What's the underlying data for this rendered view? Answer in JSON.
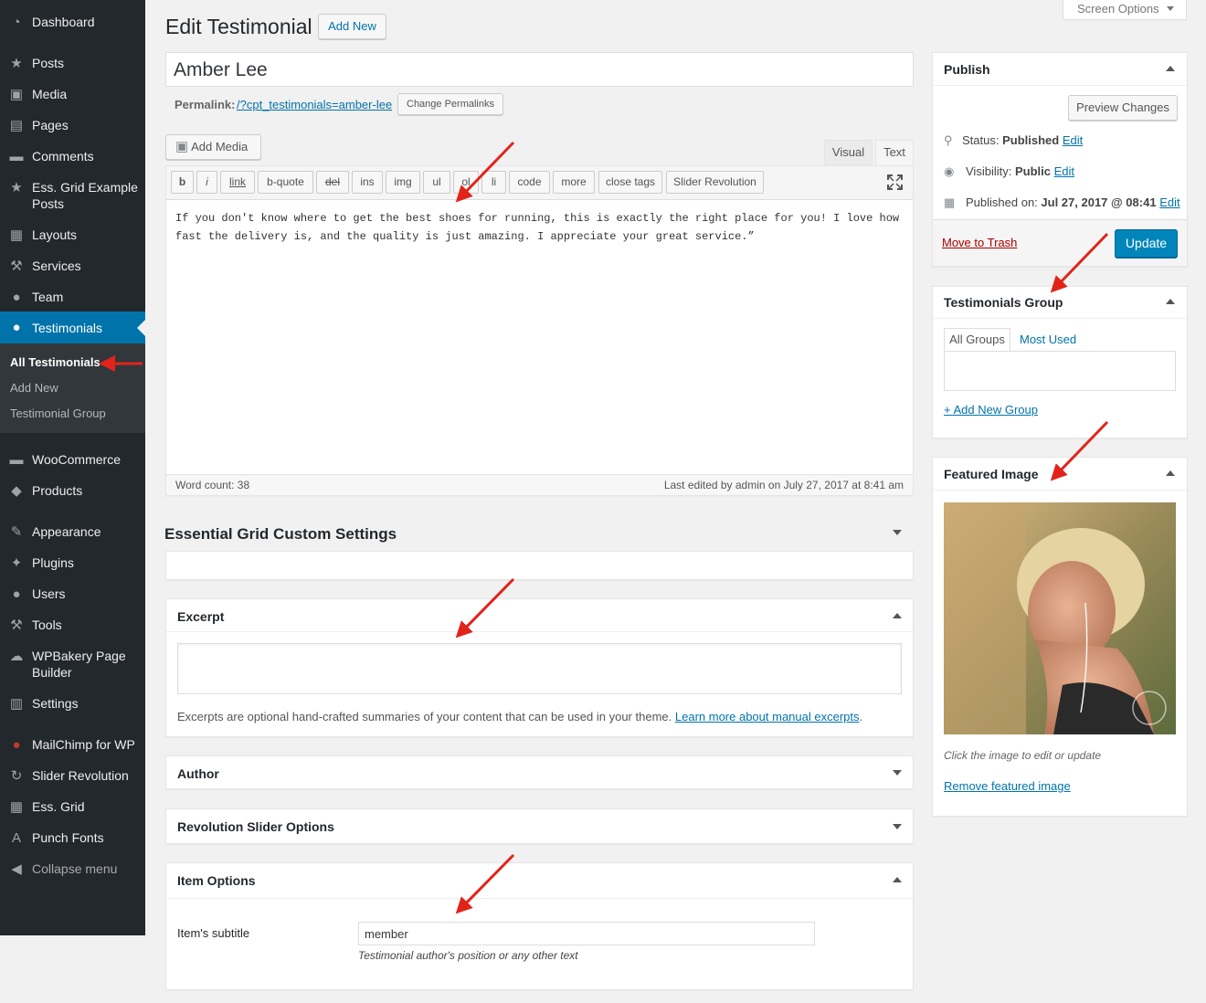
{
  "sidebar": {
    "items": [
      {
        "label": "Dashboard",
        "icon": "dashboard-icon",
        "glyph": "◔"
      },
      {
        "label": "Posts",
        "icon": "pushpin-icon",
        "glyph": "★"
      },
      {
        "label": "Media",
        "icon": "media-icon",
        "glyph": "▣"
      },
      {
        "label": "Pages",
        "icon": "pages-icon",
        "glyph": "▤"
      },
      {
        "label": "Comments",
        "icon": "comment-icon",
        "glyph": "▬"
      },
      {
        "label": "Ess. Grid Example Posts",
        "icon": "pushpin-icon",
        "glyph": "★"
      },
      {
        "label": "Layouts",
        "icon": "keyboard-icon",
        "glyph": "▦"
      },
      {
        "label": "Services",
        "icon": "wrench-icon",
        "glyph": "⚒"
      },
      {
        "label": "Team",
        "icon": "user-icon",
        "glyph": "●"
      },
      {
        "label": "Testimonials",
        "icon": "speech-bubble-icon",
        "glyph": "●"
      },
      {
        "label": "WooCommerce",
        "icon": "woo-icon",
        "glyph": "▬"
      },
      {
        "label": "Products",
        "icon": "box-icon",
        "glyph": "◆"
      },
      {
        "label": "Appearance",
        "icon": "paintbrush-icon",
        "glyph": "✎"
      },
      {
        "label": "Plugins",
        "icon": "plug-icon",
        "glyph": "✦"
      },
      {
        "label": "Users",
        "icon": "users-icon",
        "glyph": "●"
      },
      {
        "label": "Tools",
        "icon": "wrench-icon",
        "glyph": "⚒"
      },
      {
        "label": "WPBakery Page Builder",
        "icon": "cloud-icon",
        "glyph": "☁"
      },
      {
        "label": "Settings",
        "icon": "sliders-icon",
        "glyph": "▥"
      },
      {
        "label": "MailChimp for WP",
        "icon": "mailchimp-icon",
        "glyph": "●"
      },
      {
        "label": "Slider Revolution",
        "icon": "refresh-icon",
        "glyph": "↻"
      },
      {
        "label": "Ess. Grid",
        "icon": "grid-icon",
        "glyph": "▦"
      },
      {
        "label": "Punch Fonts",
        "icon": "letter-a-icon",
        "glyph": "A"
      },
      {
        "label": "Collapse menu",
        "icon": "collapse-icon",
        "glyph": "◀"
      }
    ],
    "submenu": [
      "All Testimonials",
      "Add New",
      "Testimonial Group"
    ]
  },
  "header": {
    "title": "Edit Testimonial",
    "add_new": "Add New",
    "screen_options": "Screen Options"
  },
  "post": {
    "title": "Amber Lee",
    "permalink_label": "Permalink:",
    "permalink_url": "/?cpt_testimonials=amber-lee",
    "change_permalinks": "Change Permalinks"
  },
  "editor": {
    "add_media": "Add Media",
    "tab_visual": "Visual",
    "tab_text": "Text",
    "quicktags": [
      "b",
      "i",
      "link",
      "b-quote",
      "del",
      "ins",
      "img",
      "ul",
      "ol",
      "li",
      "code",
      "more",
      "close tags",
      "Slider Revolution"
    ],
    "content": "If you don't know where to get the best shoes for running, this is exactly the right place for you! I love how fast the delivery is, and the quality is just amazing. I appreciate your great service.”",
    "word_count": "Word count: 38",
    "last_edited": "Last edited by admin on July 27, 2017 at 8:41 am"
  },
  "boxes": {
    "essential_grid": "Essential Grid Custom Settings",
    "excerpt_title": "Excerpt",
    "excerpt_help": "Excerpts are optional hand-crafted summaries of your content that can be used in your theme.",
    "excerpt_link": "Learn more about manual excerpts",
    "excerpt_period": ".",
    "author": "Author",
    "revolution": "Revolution Slider Options",
    "item_options": "Item Options",
    "item_subtitle_label": "Item's subtitle",
    "item_subtitle_value": "member",
    "item_subtitle_help": "Testimonial author's position or any other text"
  },
  "publish": {
    "title": "Publish",
    "preview": "Preview Changes",
    "status_label": "Status:",
    "status_value": "Published",
    "visibility_label": "Visibility:",
    "visibility_value": "Public",
    "published_label": "Published on:",
    "published_value": "Jul 27, 2017 @ 08:41",
    "edit": "Edit",
    "trash": "Move to Trash",
    "update": "Update"
  },
  "groups": {
    "title": "Testimonials Group",
    "tab_all": "All Groups",
    "tab_most": "Most Used",
    "add_new": "+ Add New Group"
  },
  "featured": {
    "title": "Featured Image",
    "hint": "Click the image to edit or update",
    "remove": "Remove featured image"
  },
  "colors": {
    "sidebar_bg": "#23282d",
    "accent": "#0073aa",
    "trash": "#a00",
    "annotation_arrow": "#e2231a"
  }
}
